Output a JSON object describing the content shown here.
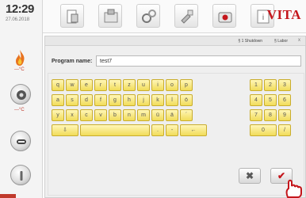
{
  "sidebar": {
    "time": "12:29",
    "date": "27.06.2018",
    "temps": [
      "---°C",
      "---°C"
    ]
  },
  "toolbar": {
    "brand": "VITA"
  },
  "dialog": {
    "tabs": [
      "§ 1 Shutdown",
      "§ Labor"
    ],
    "close": "x",
    "name_label": "Program name:",
    "name_value": "test7"
  },
  "keyboard": {
    "rows": [
      [
        "q",
        "w",
        "e",
        "r",
        "t",
        "z",
        "u",
        "i",
        "o",
        "p"
      ],
      [
        "a",
        "s",
        "d",
        "f",
        "g",
        "h",
        "j",
        "k",
        "l",
        "ö"
      ],
      [
        "y",
        "x",
        "c",
        "v",
        "b",
        "n",
        "m",
        "ü",
        "ä",
        "´"
      ]
    ],
    "numpad": [
      [
        "1",
        "2",
        "3"
      ],
      [
        "4",
        "5",
        "6"
      ],
      [
        "7",
        "8",
        "9"
      ]
    ],
    "shift": "⇩",
    "space": "",
    "dash": "-",
    "dot": ".",
    "backspace": "←",
    "zero": "0",
    "slash": "/"
  },
  "actions": {
    "cancel": "✖",
    "ok": "✔"
  },
  "colors": {
    "brand": "#c4161c",
    "key": "#f3de5e"
  }
}
